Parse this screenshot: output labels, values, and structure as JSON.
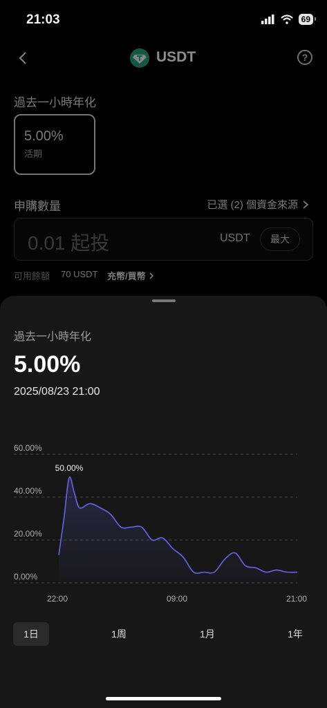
{
  "status_bar": {
    "time": "21:03",
    "battery": "69"
  },
  "header": {
    "title": "USDT",
    "help_glyph": "?",
    "icons": [
      "back-icon",
      "usdt-coin-icon",
      "help-icon"
    ]
  },
  "form": {
    "rate_section_label": "過去一小時年化",
    "rate_card": {
      "value": "5.00%",
      "type": "活期"
    },
    "subscription_label": "申購數量",
    "source_link": "已選 (2) 個資金來源",
    "amount_placeholder": "0.01 起投",
    "amount_unit": "USDT",
    "max_button": "最大",
    "available_label": "可用餘額",
    "available_value": "70 USDT",
    "deposit_link": "充幣/買幣"
  },
  "sheet": {
    "label": "過去一小時年化",
    "rate": "5.00%",
    "datetime": "2025/08/23 21:00",
    "period_tabs": [
      "1日",
      "1周",
      "1月",
      "1年"
    ],
    "active_tab": "1日"
  },
  "chart_data": {
    "type": "area",
    "y_ticks": [
      "60.00%",
      "40.00%",
      "20.00%",
      "0.00%"
    ],
    "x_ticks": [
      "22:00",
      "09:00",
      "21:00"
    ],
    "ylim": [
      0,
      60
    ],
    "grid": true,
    "peak_label": "50.00%",
    "line_color": "#6b63e6",
    "x": [
      0,
      0.5,
      1,
      1.5,
      2,
      3,
      4,
      5,
      6,
      7,
      8,
      9,
      10,
      11,
      12,
      13,
      14,
      15,
      16,
      17,
      18,
      19,
      20,
      21,
      22,
      23
    ],
    "values": [
      13,
      30,
      49,
      42,
      35,
      37,
      35,
      32,
      26,
      26,
      26,
      20,
      21,
      16,
      12,
      5,
      5,
      5,
      11,
      14,
      8,
      7,
      5,
      6,
      5,
      5
    ]
  },
  "colors": {
    "accent": "#6b63e6",
    "coin": "#26a17b"
  }
}
